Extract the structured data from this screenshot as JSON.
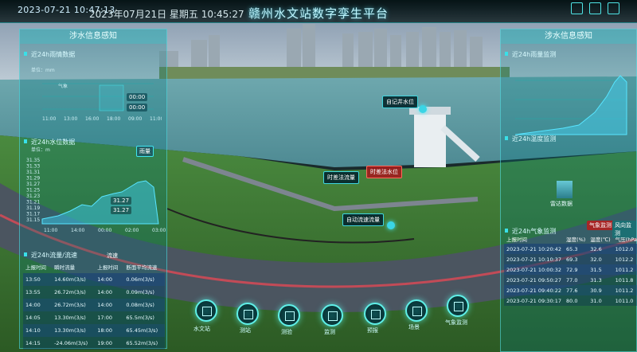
{
  "header": {
    "datetime": "2023-07-21 10:47:13",
    "overlay_datetime": "2023年07月21日 星期五 10:45:27",
    "title": "赣州水文站数字孪生平台"
  },
  "left_panel": {
    "title": "涉水信息感知",
    "level_chart": {
      "title": "近24h雨情数据",
      "unit_label": "单位：mm",
      "y_label": "气象",
      "x_ticks": [
        "11:00",
        "13:00",
        "16:00",
        "18:00",
        "09:00",
        "11:00"
      ],
      "values": [
        "00:00",
        "00:00"
      ]
    },
    "rain_chart": {
      "title": "近24h水位数据",
      "unit_label": "单位：m",
      "badge": "雨量",
      "y_ticks": [
        "31.35",
        "31.33",
        "31.31",
        "31.29",
        "31.27",
        "31.25",
        "31.23",
        "31.21",
        "31.19",
        "31.17",
        "31.15"
      ],
      "x_ticks": [
        "11:00",
        "14:00",
        "00:00",
        "02:00",
        "03:00"
      ],
      "readouts": [
        "31.27",
        "31.27"
      ]
    },
    "flow_section_title": "近24h流量/流速",
    "flow_label": "流速",
    "table": {
      "headers": [
        "上报时间",
        "瞬时流量",
        "上报时间",
        "断面平均流速"
      ],
      "rows": [
        [
          "13:50",
          "14.60m(3/s)",
          "14:00",
          "0.06m(3/s)"
        ],
        [
          "13:55",
          "26.72m(3/s)",
          "14:00",
          "0.09m(3/s)"
        ],
        [
          "14:00",
          "26.72m(3/s)",
          "14:00",
          "0.08m(3/s)"
        ],
        [
          "14:05",
          "13.30m(3/s)",
          "17:00",
          "65.5m(3/s)"
        ],
        [
          "14:10",
          "13.30m(3/s)",
          "18:00",
          "65.45m(3/s)"
        ],
        [
          "14:15",
          "-24.06m(3/s)",
          "19:00",
          "65.52m(3/s)"
        ]
      ]
    }
  },
  "right_panel": {
    "title": "涉水信息感知",
    "chart1_title": "近24h雨量监测",
    "chart2_title": "近24h温度监测",
    "chart_label": "雷达数据",
    "weather_title": "近24h气象监测",
    "weather_badges": [
      "气象监测",
      "风向监测"
    ],
    "table": {
      "headers": [
        "上报时间",
        "湿度(%)",
        "温度(℃)",
        "气压(hPa)"
      ],
      "rows": [
        [
          "2023-07-21 10:20:42",
          "65.3",
          "32.6",
          "1012.0"
        ],
        [
          "2023-07-21 10:10:37",
          "69.3",
          "32.0",
          "1012.2"
        ],
        [
          "2023-07-21 10:00:32",
          "72.9",
          "31.5",
          "1011.2"
        ],
        [
          "2023-07-21 09:50:27",
          "77.0",
          "31.3",
          "1011.8"
        ],
        [
          "2023-07-21 09:40:22",
          "77.6",
          "30.9",
          "1011.2"
        ],
        [
          "2023-07-21 09:30:17",
          "80.0",
          "31.0",
          "1011.0"
        ]
      ]
    }
  },
  "map_tags": {
    "recorder": "自记井水位",
    "time_diff_flow": "时差法流量",
    "time_diff_level": "时差法水位",
    "auto_flow": "自动流速流量"
  },
  "dock": {
    "items": [
      {
        "label": "水文站"
      },
      {
        "label": "测站"
      },
      {
        "label": "测验"
      },
      {
        "label": "监测"
      },
      {
        "label": "预报"
      },
      {
        "label": "场景"
      },
      {
        "label": "气象监测"
      }
    ]
  },
  "colors": {
    "accent": "#3fe6ee",
    "panel": "#0b6f74",
    "water": "#5fa7b0",
    "grass": "#3f7a34",
    "road": "#4c5560"
  }
}
